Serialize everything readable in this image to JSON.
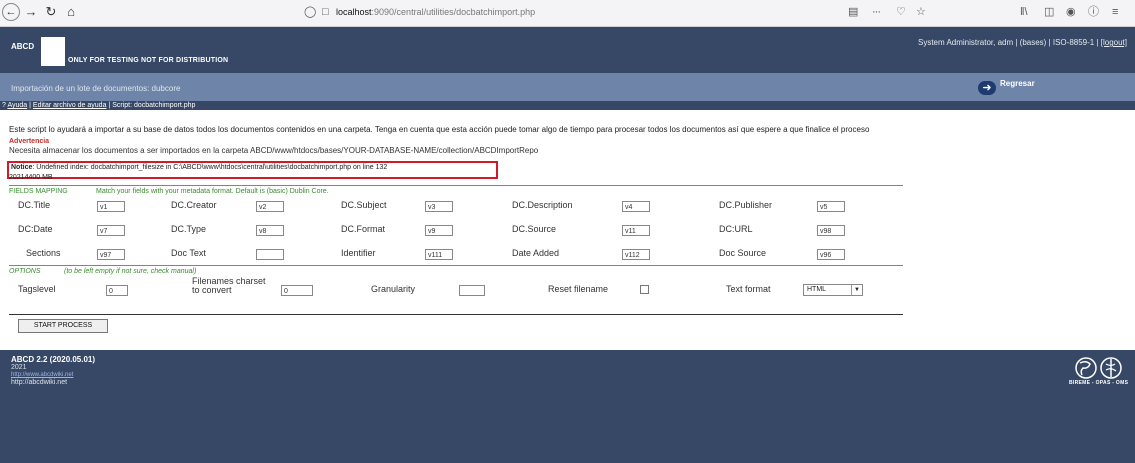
{
  "browser": {
    "url_host": "localhost",
    "url_rest": ":9090/central/utilities/docbatchimport.php",
    "right_icons": [
      "library-icon",
      "reader-icon",
      "account-icon",
      "info-icon",
      "menu-icon"
    ]
  },
  "header": {
    "logo_text": "ABCD",
    "subtitle": "ONLY FOR TESTING  NOT FOR DISTRIBUTION",
    "user_info": "System Administrator, adm | (bases) | ISO-8859-1 | ",
    "logout_label": "[logout]"
  },
  "titlebar": {
    "title": "Importación de un lote de documentos: dubcore",
    "regresar_label": "Regresar"
  },
  "help": {
    "prefix": "?",
    "ayuda": "Ayuda",
    "editar": "Editar archivo de ayuda",
    "script": "Script: docbatchimport.php"
  },
  "content": {
    "intro": "Este script lo ayudará a importar a su base de datos todos los documentos contenidos en una carpeta. Tenga en cuenta que esta acción puede tomar algo de tiempo para procesar todos los documentos así que espere a que finalice el proceso",
    "warning_title": "Advertencia",
    "warning_text": "Necesita almacenar los documentos a ser importados en la carpeta ABCD/www/htdocs/bases/YOUR-DATABASE-NAME/collection/ABCDImportRepo",
    "notice_label": "Notice",
    "notice_text": ": Undefined index: docbatchimport_filesize in C:\\ABCD\\www\\htdocs\\central\\utilities\\docbatchimport.php on line 132",
    "size_text": "20214400 MB"
  },
  "fields_mapping": {
    "label": "FIELDS MAPPING",
    "hint": "Match your fields with your metadata format. Default is (basic) Dublin Core.",
    "rows": [
      [
        {
          "label": "DC.Title",
          "value": "v1"
        },
        {
          "label": "DC.Creator",
          "value": "v2"
        },
        {
          "label": "DC.Subject",
          "value": "v3"
        },
        {
          "label": "DC.Description",
          "value": "v4"
        },
        {
          "label": "DC.Publisher",
          "value": "v5"
        }
      ],
      [
        {
          "label": "DC:Date",
          "value": "v7"
        },
        {
          "label": "DC.Type",
          "value": "v8"
        },
        {
          "label": "DC.Format",
          "value": "v9"
        },
        {
          "label": "DC.Source",
          "value": "v11"
        },
        {
          "label": "DC:URL",
          "value": "v98"
        }
      ],
      [
        {
          "label": "Sections",
          "value": "v97"
        },
        {
          "label": "Doc Text",
          "value": ""
        },
        {
          "label": "Identifier",
          "value": "v111"
        },
        {
          "label": "Date Added",
          "value": "v112"
        },
        {
          "label": "Doc Source",
          "value": "v96"
        }
      ]
    ]
  },
  "options": {
    "label": "OPTIONS",
    "hint": "(to be left empty if not sure, check manual)",
    "tagslevel_label": "Tagslevel",
    "tagslevel_value": "0",
    "charset_label_1": "Filenames charset",
    "charset_label_2": "to convert",
    "charset_value": "0",
    "granularity_label": "Granularity",
    "granularity_value": "",
    "reset_label": "Reset filename",
    "textformat_label": "Text format",
    "textformat_value": "HTML"
  },
  "start_button": "START PROCESS",
  "footer": {
    "version": "ABCD 2.2  (2020.05.01)",
    "year": "2021",
    "link1": "http://www.abcdwiki.net",
    "link2": "http://abcdwiki.net",
    "partner_logo_text": "BIREME - OPAS - OMS"
  }
}
